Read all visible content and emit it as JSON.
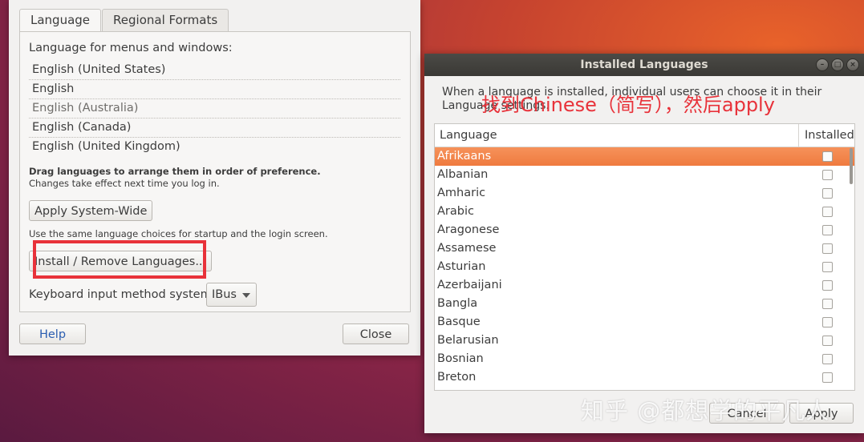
{
  "language_window": {
    "tabs": [
      "Language",
      "Regional Formats"
    ],
    "section_label": "Language for menus and windows:",
    "languages": [
      "English (United States)",
      "English",
      "English (Australia)",
      "English (Canada)",
      "English (United Kingdom)"
    ],
    "drag_hint": "Drag languages to arrange them in order of preference.",
    "effect_hint": "Changes take effect next time you log in.",
    "apply_system_wide_label": "Apply System-Wide",
    "apply_hint": "Use the same language choices for startup and the login screen.",
    "install_remove_label": "Install / Remove Languages...",
    "keyboard_label": "Keyboard input method system:",
    "keyboard_value": "IBus",
    "help_label": "Help",
    "close_label": "Close"
  },
  "installed_window": {
    "title": "Installed Languages",
    "description": "When a language is installed, individual users can choose it in their Language settings.",
    "annotation": "找到Chinese（简写），然后apply",
    "columns": [
      "Language",
      "Installed"
    ],
    "languages": [
      "Afrikaans",
      "Albanian",
      "Amharic",
      "Arabic",
      "Aragonese",
      "Assamese",
      "Asturian",
      "Azerbaijani",
      "Bangla",
      "Basque",
      "Belarusian",
      "Bosnian",
      "Breton"
    ],
    "selected_language": "Afrikaans",
    "cancel_label": "Cancel",
    "apply_label": "Apply"
  },
  "watermark": "知乎 @都想学的平凡人",
  "colors": {
    "selection": "#ef7a3f",
    "annotation_red": "#e8323a",
    "link_blue": "#2a5db0"
  }
}
